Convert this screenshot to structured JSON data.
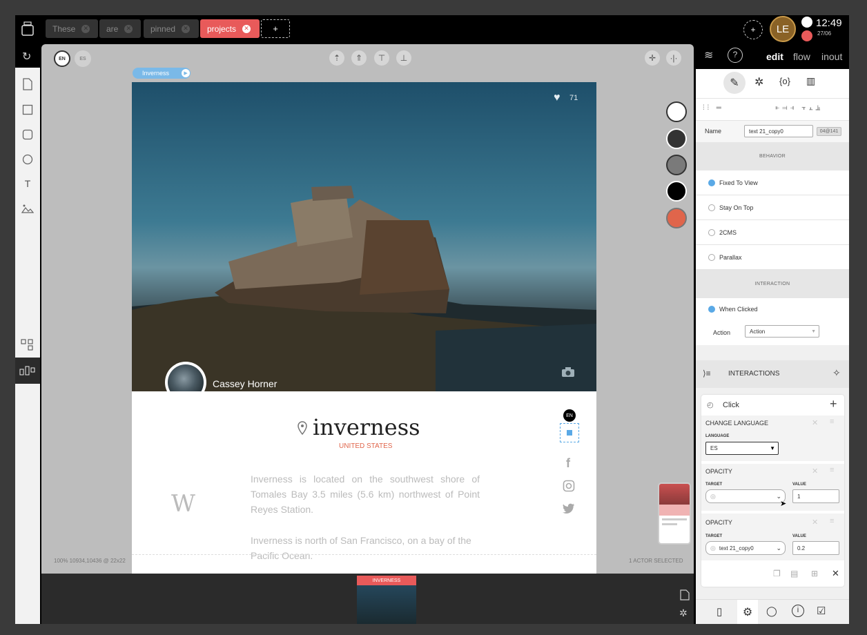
{
  "tabs": [
    {
      "label": "These",
      "active": false
    },
    {
      "label": "are",
      "active": false
    },
    {
      "label": "pinned",
      "active": false
    },
    {
      "label": "projects",
      "active": true
    }
  ],
  "newtab_label": "+",
  "clock": {
    "time": "12:49",
    "date": "27/06"
  },
  "avatar_initials": "LE",
  "canvas": {
    "lang_en": "EN",
    "lang_es": "ES",
    "badge_label": "Inverness",
    "status_left": "100% 10934,10436 @ 22x22",
    "status_right": "1 ACTOR SELECTED"
  },
  "card": {
    "likes": "71",
    "author": "Cassey Horner",
    "title": "inverness",
    "subtitle": "UNITED STATES",
    "wiki_glyph": "W",
    "paragraph1": "Inverness is located on the southwest shore of Tomales Bay 3.5 miles (5.6 km) northwest of Point Reyes Station.",
    "paragraph2": "Inverness is north of San Francisco, on a bay of the Pacific Ocean.",
    "lang_marker": "EN"
  },
  "swatch_colors": [
    "#ffffff",
    "#333333",
    "#7a7a7a",
    "#000000",
    "#e0654b"
  ],
  "filmstrip": {
    "label": "INVERNESS",
    "label_color": "#e85a5a"
  },
  "right_panel": {
    "modes": {
      "edit": "edit",
      "flow": "flow",
      "inout": "inout"
    },
    "name_label": "Name",
    "name_value": "text 21_copy0",
    "name_badge": "04@141",
    "behavior_header": "BEHAVIOR",
    "behaviors": [
      {
        "label": "Fixed To View",
        "checked": true
      },
      {
        "label": "Stay On Top",
        "checked": false
      },
      {
        "label": "2CMS",
        "checked": false
      },
      {
        "label": "Parallax",
        "checked": false
      }
    ],
    "interaction_header": "INTERACTION",
    "when_clicked": "When Clicked",
    "action_label": "Action",
    "action_value": "Action",
    "interactions_title": "INTERACTIONS",
    "event_label": "Click",
    "change_language": {
      "title": "CHANGE LANGUAGE",
      "field_label": "LANGUAGE",
      "value": "ES"
    },
    "opacity1": {
      "title": "OPACITY",
      "target_label": "TARGET",
      "value_label": "VALUE",
      "target": "",
      "value": "1"
    },
    "opacity2": {
      "title": "OPACITY",
      "target_label": "TARGET",
      "value_label": "VALUE",
      "target": "text 21_copy0",
      "value": "0.2"
    }
  },
  "accent_color": "#5aa9e6"
}
